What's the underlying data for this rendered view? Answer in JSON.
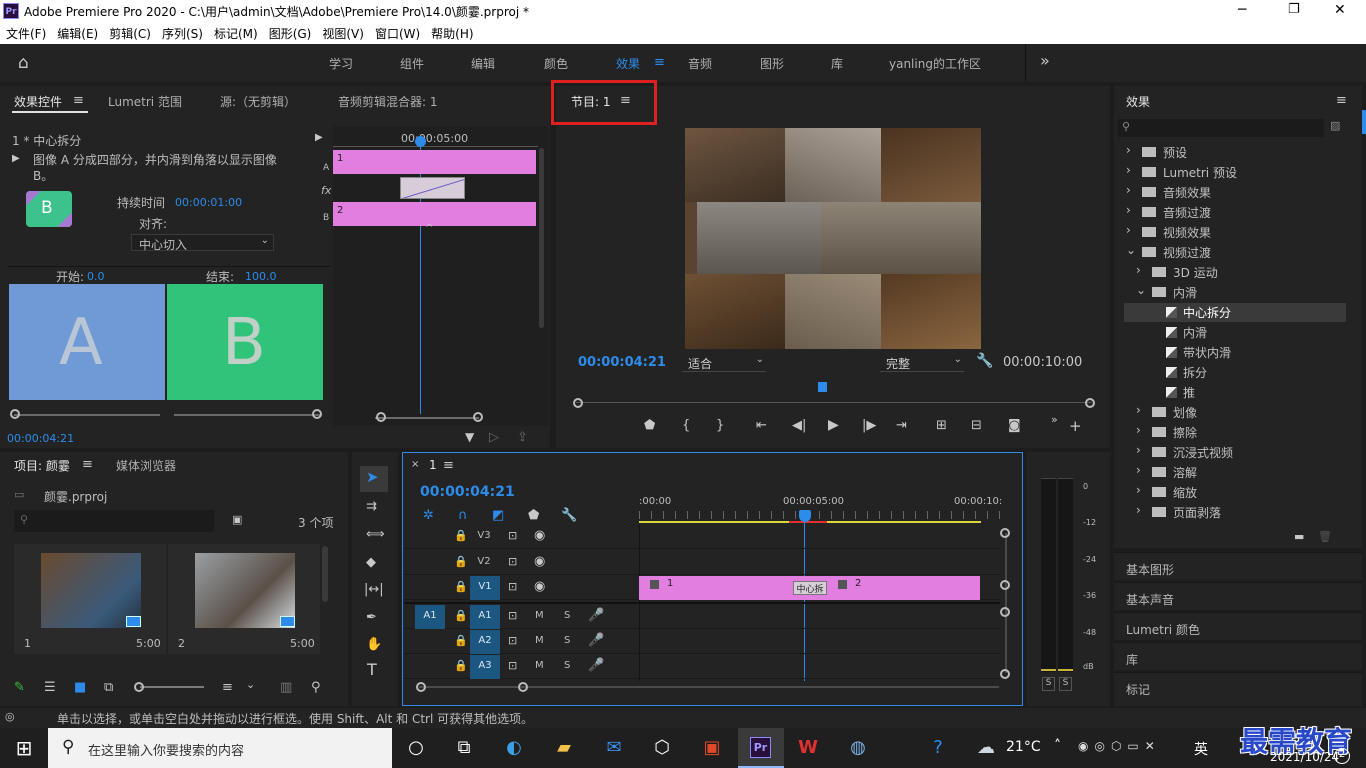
{
  "title": "Adobe Premiere Pro 2020 - C:\\用户\\admin\\文档\\Adobe\\Premiere Pro\\14.0\\颜霎.prproj *",
  "app_badge": "Pr",
  "window": {
    "min": "─",
    "max": "❐",
    "close": "✕"
  },
  "menu": [
    "文件(F)",
    "编辑(E)",
    "剪辑(C)",
    "序列(S)",
    "标记(M)",
    "图形(G)",
    "视图(V)",
    "窗口(W)",
    "帮助(H)"
  ],
  "workspaces": [
    "学习",
    "组件",
    "编辑",
    "颜色",
    "效果",
    "音频",
    "图形",
    "库",
    "yanling的工作区"
  ],
  "active_workspace": "效果",
  "more": "»",
  "source_tabs": [
    "效果控件",
    "Lumetri 范围",
    "源:（无剪辑）",
    "音频剪辑混合器: 1"
  ],
  "effect_controls": {
    "clip": "1 * 中心拆分",
    "desc": "图像 A 分成四部分，并内滑到角落以显示图像 B。",
    "thumb": "B",
    "duration_label": "持续时间",
    "duration": "00:00:01:00",
    "align_label": "对齐:",
    "align_value": "中心切入",
    "start_label": "开始:",
    "start_value": "0.0",
    "end_label": "结束:",
    "end_value": "100.0",
    "a": "A",
    "b": "B",
    "timecode": "00:00:04:21",
    "ruler": "00:00:05:00",
    "trackA": "A",
    "trackB": "B",
    "clip1": "1",
    "clip2": "2",
    "fx": "fx"
  },
  "program": {
    "tab": "节目: 1",
    "timecode": "00:00:04:21",
    "fit": "适合",
    "quality": "完整",
    "duration": "00:00:10:00"
  },
  "project": {
    "tabs": [
      "项目: 颜霎",
      "媒体浏览器"
    ],
    "file": "颜霎.prproj",
    "count": "3 个项",
    "items": [
      {
        "num": "1",
        "dur": "5:00"
      },
      {
        "num": "2",
        "dur": "5:00"
      }
    ]
  },
  "timeline": {
    "tab": "1",
    "timecode": "00:00:04:21",
    "ruler": [
      ":00:00",
      "00:00:05:00",
      "00:00:10:"
    ],
    "tracks": [
      "V3",
      "V2",
      "V1",
      "A1",
      "A2",
      "A3"
    ],
    "source_a1": "A1",
    "clip1": "1",
    "clip2": "2",
    "transition": "中心拆",
    "m": "M",
    "s": "S"
  },
  "meter": {
    "scale": [
      "0",
      "-12",
      "-24",
      "-36",
      "-48",
      "dB"
    ],
    "solo": [
      "S",
      "S"
    ]
  },
  "effects": {
    "tab": "效果",
    "tree": [
      {
        "label": "预设",
        "level": 0,
        "type": "folder"
      },
      {
        "label": "Lumetri 预设",
        "level": 0,
        "type": "folder"
      },
      {
        "label": "音频效果",
        "level": 0,
        "type": "folder"
      },
      {
        "label": "音频过渡",
        "level": 0,
        "type": "folder"
      },
      {
        "label": "视频效果",
        "level": 0,
        "type": "folder"
      },
      {
        "label": "视频过渡",
        "level": 0,
        "type": "folder",
        "open": true
      },
      {
        "label": "3D 运动",
        "level": 1,
        "type": "folder"
      },
      {
        "label": "内滑",
        "level": 1,
        "type": "folder",
        "open": true
      },
      {
        "label": "中心拆分",
        "level": 2,
        "type": "fx",
        "selected": true
      },
      {
        "label": "内滑",
        "level": 2,
        "type": "fx"
      },
      {
        "label": "带状内滑",
        "level": 2,
        "type": "fx"
      },
      {
        "label": "拆分",
        "level": 2,
        "type": "fx"
      },
      {
        "label": "推",
        "level": 2,
        "type": "fx"
      },
      {
        "label": "划像",
        "level": 1,
        "type": "folder"
      },
      {
        "label": "擦除",
        "level": 1,
        "type": "folder"
      },
      {
        "label": "沉浸式视频",
        "level": 1,
        "type": "folder"
      },
      {
        "label": "溶解",
        "level": 1,
        "type": "folder"
      },
      {
        "label": "缩放",
        "level": 1,
        "type": "folder"
      },
      {
        "label": "页面剥落",
        "level": 1,
        "type": "folder"
      }
    ],
    "panels": [
      "基本图形",
      "基本声音",
      "Lumetri 颜色",
      "库",
      "标记"
    ]
  },
  "status": "单击以选择，或单击空白处并拖动以进行框选。使用 Shift、Alt 和 Ctrl 可获得其他选项。",
  "taskbar": {
    "search": "在这里输入你要搜索的内容",
    "weather": "21°C",
    "ime": "英",
    "date": "2021/10/24",
    "time": "",
    "watermark": "最需教育",
    "notif": "2"
  },
  "colors": {
    "accent": "#2d8ceb",
    "highlight_box": "#e02020",
    "clip": "#e27ee0",
    "b_tile": "#2fc47a",
    "a_tile": "#6f9ad6"
  }
}
